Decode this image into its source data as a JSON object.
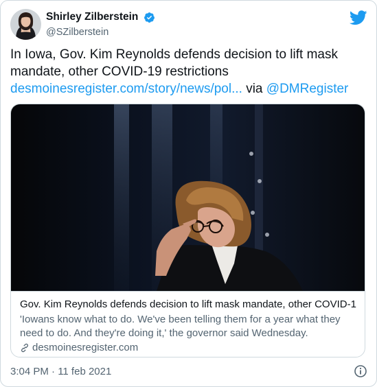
{
  "tweet": {
    "author": {
      "display_name": "Shirley Zilberstein",
      "handle": "@SZilberstein",
      "verified": true,
      "avatar_icon": "avatar-photo"
    },
    "text": {
      "body": "In Iowa, Gov. Kim Reynolds defends decision to lift mask mandate, other COVID-19 restrictions",
      "link": "desmoinesregister.com/story/news/pol...",
      "via": " via ",
      "mention": "@DMRegister"
    },
    "card": {
      "title": "Gov. Kim Reynolds defends decision to lift mask mandate, other COVID-1...",
      "description": "'Iowans know what to do. We've been telling them for a year what they need to do. And they're doing it,' the governor said Wednesday.",
      "domain": "desmoinesregister.com"
    },
    "timestamp": "3:04 PM · 11 feb 2021"
  },
  "colors": {
    "link": "#1d9bf0",
    "twitter_blue": "#1d9bf0",
    "text": "#0f1419",
    "secondary": "#536471",
    "border": "#cfd9de"
  },
  "icons": [
    "verified-badge-icon",
    "twitter-bird-icon",
    "link-icon",
    "info-icon"
  ]
}
